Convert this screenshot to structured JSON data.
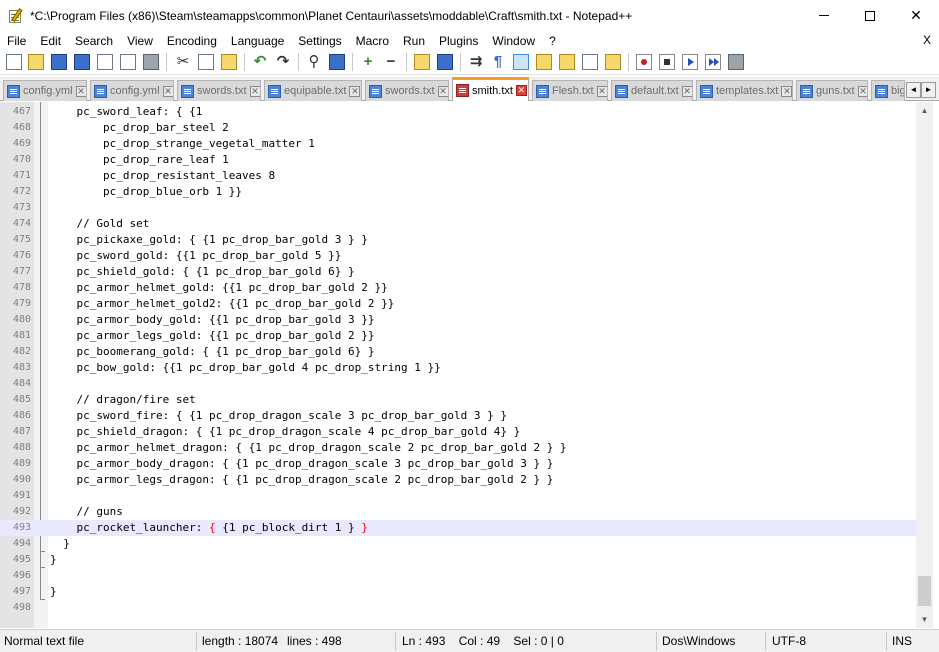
{
  "window": {
    "title": "*C:\\Program Files (x86)\\Steam\\steamapps\\common\\Planet Centauri\\assets\\moddable\\Craft\\smith.txt - Notepad++",
    "minimize_glyph": "—",
    "maximize_glyph": "☐",
    "close_glyph": "✕"
  },
  "menu": {
    "items": [
      "File",
      "Edit",
      "Search",
      "View",
      "Encoding",
      "Language",
      "Settings",
      "Macro",
      "Run",
      "Plugins",
      "Window",
      "?"
    ],
    "close_doc": "X"
  },
  "toolbar": {
    "icons": [
      "new-file-icon",
      "open-file-icon",
      "save-icon",
      "save-all-icon",
      "close-icon",
      "close-all-icon",
      "print-icon",
      "cut-icon",
      "copy-icon",
      "paste-icon",
      "undo-icon",
      "redo-icon",
      "find-icon",
      "replace-icon",
      "zoom-in-icon",
      "zoom-out-icon",
      "sync-v-icon",
      "sync-h-icon",
      "word-wrap-icon",
      "all-chars-icon",
      "indent-guide-icon",
      "udl-icon",
      "doc-map-icon",
      "function-list-icon",
      "folder-workspace-icon",
      "record-macro-icon",
      "stop-macro-icon",
      "play-macro-icon",
      "run-macro-multiple-icon",
      "save-macro-icon"
    ]
  },
  "tabs": [
    {
      "label": "config.yml",
      "active": false
    },
    {
      "label": "config.yml",
      "active": false
    },
    {
      "label": "swords.txt",
      "active": false
    },
    {
      "label": "equipable.txt",
      "active": false
    },
    {
      "label": "swords.txt",
      "active": false
    },
    {
      "label": "smith.txt",
      "active": true
    },
    {
      "label": "Flesh.txt",
      "active": false
    },
    {
      "label": "default.txt",
      "active": false
    },
    {
      "label": "templates.txt",
      "active": false
    },
    {
      "label": "guns.txt",
      "active": false
    },
    {
      "label": "big",
      "active": false
    }
  ],
  "tab_scroll": {
    "left": "◄",
    "right": "►"
  },
  "editor": {
    "lines": [
      {
        "n": "467",
        "text": "    pc_sword_leaf: { {1"
      },
      {
        "n": "468",
        "text": "        pc_drop_bar_steel 2"
      },
      {
        "n": "469",
        "text": "        pc_drop_strange_vegetal_matter 1"
      },
      {
        "n": "470",
        "text": "        pc_drop_rare_leaf 1"
      },
      {
        "n": "471",
        "text": "        pc_drop_resistant_leaves 8"
      },
      {
        "n": "472",
        "text": "        pc_drop_blue_orb 1 }}"
      },
      {
        "n": "473",
        "text": ""
      },
      {
        "n": "474",
        "text": "    // Gold set"
      },
      {
        "n": "475",
        "text": "    pc_pickaxe_gold: { {1 pc_drop_bar_gold 3 } }"
      },
      {
        "n": "476",
        "text": "    pc_sword_gold: {{1 pc_drop_bar_gold 5 }}"
      },
      {
        "n": "477",
        "text": "    pc_shield_gold: { {1 pc_drop_bar_gold 6} }"
      },
      {
        "n": "478",
        "text": "    pc_armor_helmet_gold: {{1 pc_drop_bar_gold 2 }}"
      },
      {
        "n": "479",
        "text": "    pc_armor_helmet_gold2: {{1 pc_drop_bar_gold 2 }}"
      },
      {
        "n": "480",
        "text": "    pc_armor_body_gold: {{1 pc_drop_bar_gold 3 }}"
      },
      {
        "n": "481",
        "text": "    pc_armor_legs_gold: {{1 pc_drop_bar_gold 2 }}"
      },
      {
        "n": "482",
        "text": "    pc_boomerang_gold: { {1 pc_drop_bar_gold 6} }"
      },
      {
        "n": "483",
        "text": "    pc_bow_gold: {{1 pc_drop_bar_gold 4 pc_drop_string 1 }}"
      },
      {
        "n": "484",
        "text": ""
      },
      {
        "n": "485",
        "text": "    // dragon/fire set"
      },
      {
        "n": "486",
        "text": "    pc_sword_fire: { {1 pc_drop_dragon_scale 3 pc_drop_bar_gold 3 } }"
      },
      {
        "n": "487",
        "text": "    pc_shield_dragon: { {1 pc_drop_dragon_scale 4 pc_drop_bar_gold 4} }"
      },
      {
        "n": "488",
        "text": "    pc_armor_helmet_dragon: { {1 pc_drop_dragon_scale 2 pc_drop_bar_gold 2 } }"
      },
      {
        "n": "489",
        "text": "    pc_armor_body_dragon: { {1 pc_drop_dragon_scale 3 pc_drop_bar_gold 3 } }"
      },
      {
        "n": "490",
        "text": "    pc_armor_legs_dragon: { {1 pc_drop_dragon_scale 2 pc_drop_bar_gold 2 } }"
      },
      {
        "n": "491",
        "text": ""
      },
      {
        "n": "492",
        "text": "    // guns"
      },
      {
        "n": "493",
        "text": "    pc_rocket_launcher: { {1 pc_block_dirt 1 } }",
        "current": true
      },
      {
        "n": "494",
        "text": "  }"
      },
      {
        "n": "495",
        "text": "}"
      },
      {
        "n": "496",
        "text": ""
      },
      {
        "n": "497",
        "text": "}"
      },
      {
        "n": "498",
        "text": ""
      }
    ],
    "current_line_parts": {
      "before": "    pc_rocket_launcher: ",
      "brace_open": "{",
      "middle": " {1 pc_block_dirt 1 } ",
      "brace_close": "}"
    },
    "scroll_up": "▲",
    "scroll_down": "▼"
  },
  "status": {
    "file_type": "Normal text file",
    "length": "length : 18074",
    "lines": "lines : 498",
    "position": "Ln : 493    Col : 49    Sel : 0 | 0",
    "eol": "Dos\\Windows",
    "encoding": "UTF-8",
    "mode": "INS"
  }
}
